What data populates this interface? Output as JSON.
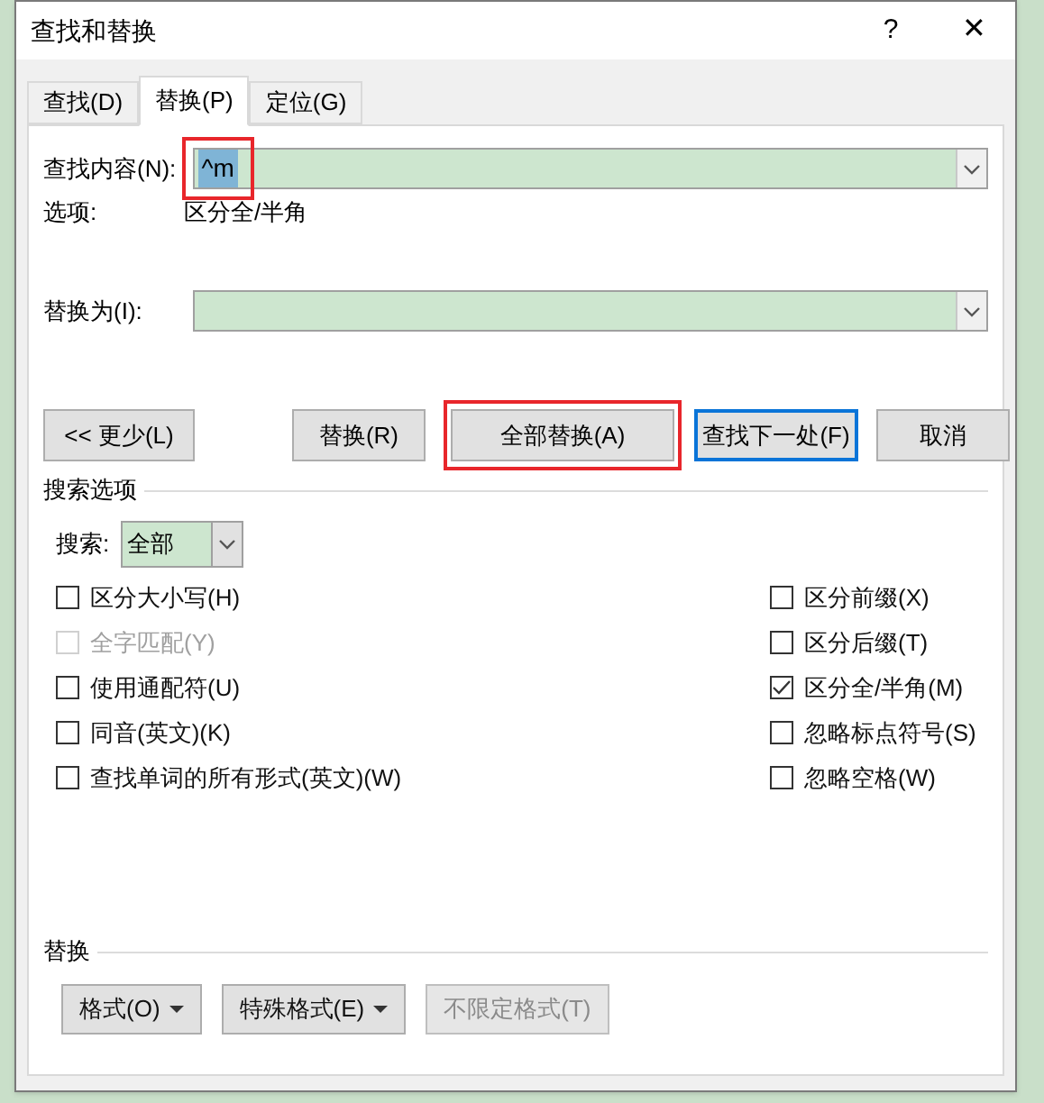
{
  "window": {
    "title": "查找和替换",
    "help": "?",
    "close": "✕"
  },
  "tabs": [
    {
      "label": "查找(D)",
      "selected": false
    },
    {
      "label": "替换(P)",
      "selected": true
    },
    {
      "label": "定位(G)",
      "selected": false
    }
  ],
  "find": {
    "label": "查找内容(N):",
    "value": "^m",
    "highlighted": true
  },
  "options": {
    "label": "选项:",
    "value": "区分全/半角"
  },
  "replace": {
    "label": "替换为(I):"
  },
  "buttons": [
    {
      "label": "<< 更少(L)",
      "kind": "plain",
      "highlighted": false
    },
    {
      "label": "替换(R)",
      "kind": "plain",
      "highlighted": false
    },
    {
      "label": "全部替换(A)",
      "kind": "plain",
      "highlighted": true
    },
    {
      "label": "查找下一处(F)",
      "kind": "default",
      "highlighted": false
    },
    {
      "label": "取消",
      "kind": "plain",
      "highlighted": false
    }
  ],
  "search_options": {
    "title": "搜索选项",
    "search_label": "搜索:",
    "search_value": "全部"
  },
  "left_checks": [
    {
      "label": "区分大小写(H)",
      "checked": false,
      "disabled": false
    },
    {
      "label": "全字匹配(Y)",
      "checked": false,
      "disabled": true
    },
    {
      "label": "使用通配符(U)",
      "checked": false,
      "disabled": false
    },
    {
      "label": "同音(英文)(K)",
      "checked": false,
      "disabled": false
    },
    {
      "label": "查找单词的所有形式(英文)(W)",
      "checked": false,
      "disabled": false
    }
  ],
  "right_checks": [
    {
      "label": "区分前缀(X)",
      "checked": false,
      "disabled": false
    },
    {
      "label": "区分后缀(T)",
      "checked": false,
      "disabled": false
    },
    {
      "label": "区分全/半角(M)",
      "checked": true,
      "disabled": false
    },
    {
      "label": "忽略标点符号(S)",
      "checked": false,
      "disabled": false
    },
    {
      "label": "忽略空格(W)",
      "checked": false,
      "disabled": false
    }
  ],
  "replace_section": {
    "title": "替换",
    "buttons": [
      {
        "label": "格式(O)",
        "menu": true,
        "disabled": false
      },
      {
        "label": "特殊格式(E)",
        "menu": true,
        "disabled": false
      },
      {
        "label": "不限定格式(T)",
        "menu": false,
        "disabled": true
      }
    ]
  }
}
